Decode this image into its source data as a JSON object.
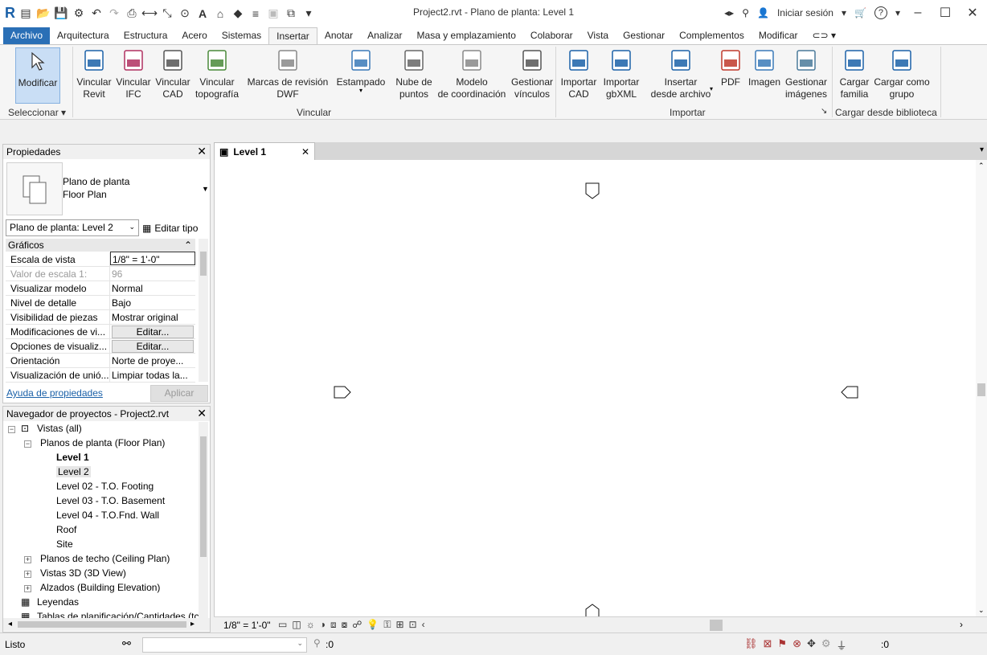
{
  "window": {
    "title": "Project2.rvt - Plano de planta: Level 1",
    "sign_in": "Iniciar sesión",
    "help": "?"
  },
  "tabs": [
    "Archivo",
    "Arquitectura",
    "Estructura",
    "Acero",
    "Sistemas",
    "Insertar",
    "Anotar",
    "Analizar",
    "Masa y emplazamiento",
    "Colaborar",
    "Vista",
    "Gestionar",
    "Complementos",
    "Modificar"
  ],
  "active_tab": "Insertar",
  "ribbon": {
    "select_panel": {
      "button": "Modificar",
      "label": "Seleccionar"
    },
    "link_panel": {
      "label": "Vincular",
      "buttons": [
        {
          "l1": "Vincular",
          "l2": "Revit",
          "icon": "link-revit-icon"
        },
        {
          "l1": "Vincular",
          "l2": "IFC",
          "icon": "link-ifc-icon"
        },
        {
          "l1": "Vincular",
          "l2": "CAD",
          "icon": "link-cad-icon"
        },
        {
          "l1": "Vincular",
          "l2": "topografía",
          "icon": "link-topography-icon"
        },
        {
          "l1": "Marcas de revisión",
          "l2": "DWF",
          "icon": "dwf-markup-icon"
        },
        {
          "l1": "Estampado",
          "l2": "",
          "icon": "decal-icon"
        },
        {
          "l1": "Nube de",
          "l2": "puntos",
          "icon": "point-cloud-icon"
        },
        {
          "l1": "Modelo",
          "l2": "de coordinación",
          "icon": "coordination-model-icon"
        },
        {
          "l1": "Gestionar",
          "l2": "vínculos",
          "icon": "manage-links-icon"
        }
      ]
    },
    "import_panel": {
      "label": "Importar",
      "buttons": [
        {
          "l1": "Importar",
          "l2": "CAD",
          "icon": "import-cad-icon"
        },
        {
          "l1": "Importar",
          "l2": "gbXML",
          "icon": "import-gbxml-icon"
        },
        {
          "l1": "Insertar",
          "l2": "desde archivo",
          "icon": "insert-from-file-icon"
        },
        {
          "l1": "PDF",
          "l2": "",
          "icon": "pdf-icon"
        },
        {
          "l1": "Imagen",
          "l2": "",
          "icon": "image-icon"
        },
        {
          "l1": "Gestionar",
          "l2": "imágenes",
          "icon": "manage-images-icon"
        }
      ]
    },
    "library_panel": {
      "label": "Cargar desde biblioteca",
      "buttons": [
        {
          "l1": "Cargar",
          "l2": "familia",
          "icon": "load-family-icon"
        },
        {
          "l1": "Cargar como",
          "l2": "grupo",
          "icon": "load-group-icon"
        }
      ]
    }
  },
  "properties": {
    "title": "Propiedades",
    "type_line1": "Plano de planta",
    "type_line2": "Floor Plan",
    "view_selector": "Plano de planta: Level 2",
    "edit_type": "Editar tipo",
    "group": "Gráficos",
    "rows": [
      {
        "k": "Escala de vista",
        "v": "1/8\" = 1'-0\""
      },
      {
        "k": "Valor de escala    1:",
        "v": "96"
      },
      {
        "k": "Visualizar modelo",
        "v": "Normal"
      },
      {
        "k": "Nivel de detalle",
        "v": "Bajo"
      },
      {
        "k": "Visibilidad de piezas",
        "v": "Mostrar original"
      },
      {
        "k": "Modificaciones de vi...",
        "v": "Editar..."
      },
      {
        "k": "Opciones de visualiz...",
        "v": "Editar..."
      },
      {
        "k": "Orientación",
        "v": "Norte de proye..."
      },
      {
        "k": "Visualización de unió...",
        "v": "Limpiar todas la..."
      }
    ],
    "help_link": "Ayuda de propiedades",
    "apply": "Aplicar"
  },
  "browser": {
    "title": "Navegador de proyectos - Project2.rvt",
    "nodes": [
      {
        "text": "Vistas (all)",
        "indent": 0,
        "exp": "−"
      },
      {
        "text": "Planos de planta (Floor Plan)",
        "indent": 1,
        "exp": "−"
      },
      {
        "text": "Level 1",
        "indent": 2,
        "bold": true
      },
      {
        "text": "Level 2",
        "indent": 2,
        "sel": true
      },
      {
        "text": "Level 02 - T.O. Footing",
        "indent": 2
      },
      {
        "text": "Level 03 - T.O. Basement",
        "indent": 2
      },
      {
        "text": "Level 04 - T.O.Fnd. Wall",
        "indent": 2
      },
      {
        "text": "Roof",
        "indent": 2
      },
      {
        "text": "Site",
        "indent": 2
      },
      {
        "text": "Planos de techo (Ceiling Plan)",
        "indent": 1,
        "exp": "+"
      },
      {
        "text": "Vistas 3D (3D View)",
        "indent": 1,
        "exp": "+"
      },
      {
        "text": "Alzados (Building Elevation)",
        "indent": 1,
        "exp": "+"
      },
      {
        "text": "Leyendas",
        "indent": 0
      },
      {
        "text": "Tablas de planificación/Cantidades (tc",
        "indent": 0
      }
    ]
  },
  "view": {
    "tab_label": "Level 1",
    "scale": "1/8\" = 1'-0\""
  },
  "status": {
    "text": "Listo",
    "selection_count": ":0",
    "filter_count": ":0"
  }
}
